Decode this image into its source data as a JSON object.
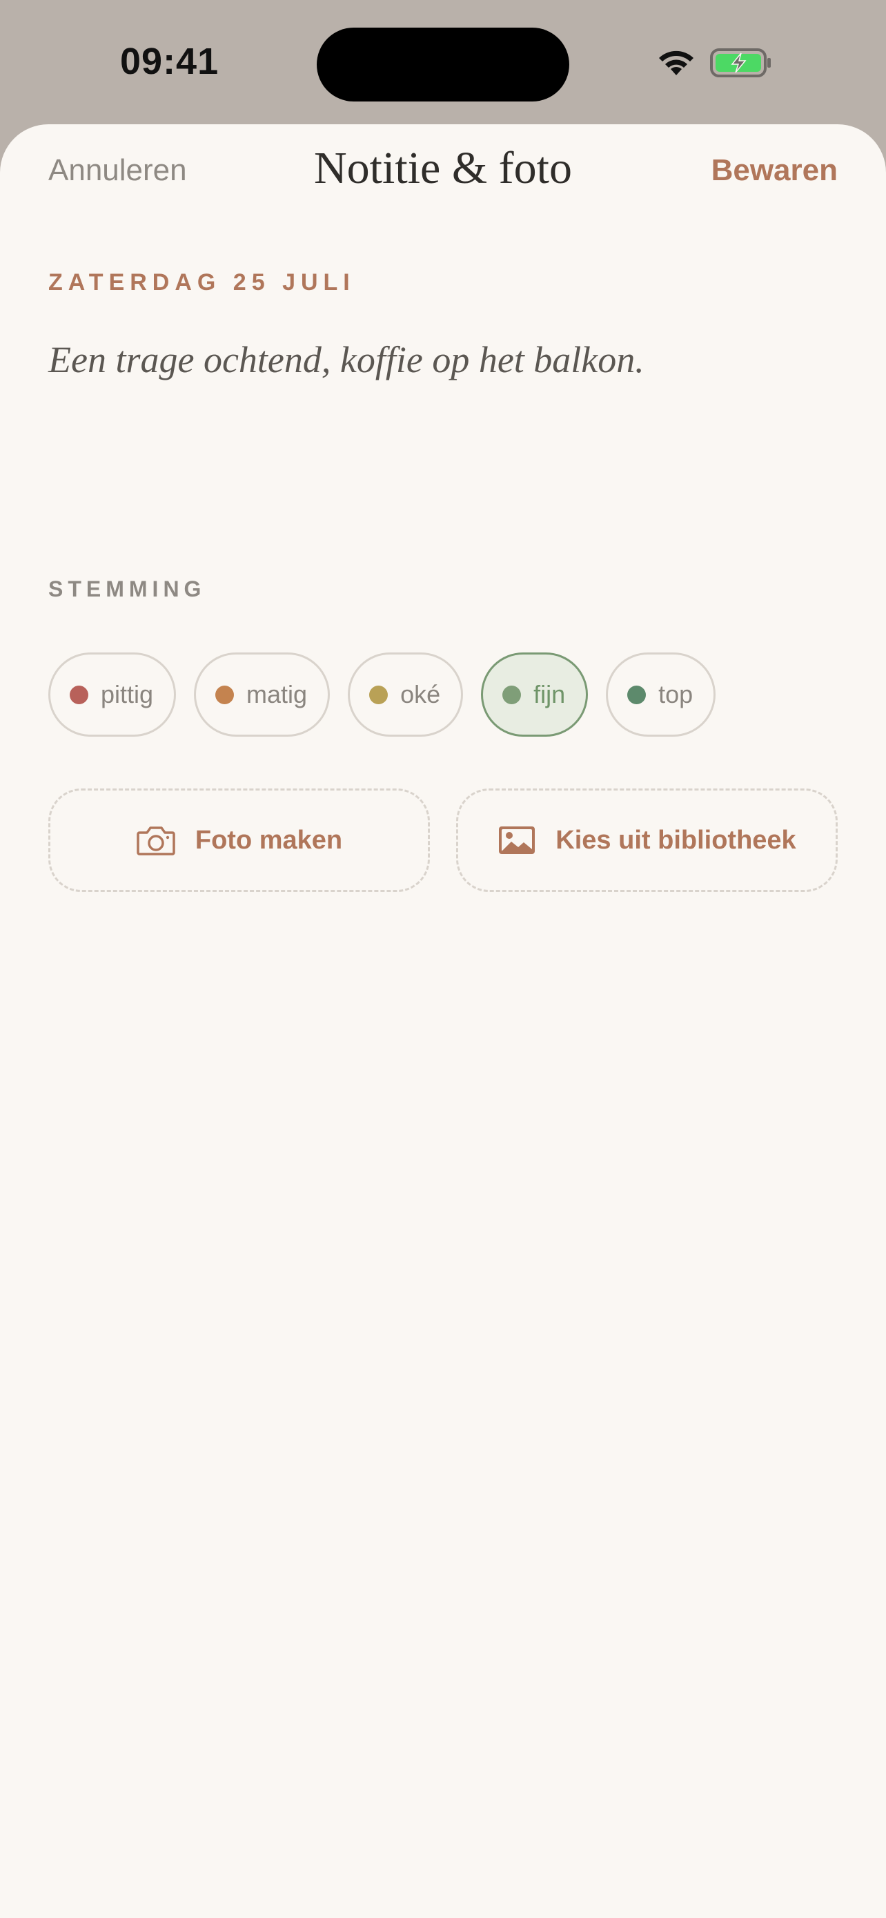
{
  "status_bar": {
    "time": "09:41",
    "icons": [
      "wifi-icon",
      "battery-charging-icon"
    ],
    "battery_color": "#4cd964"
  },
  "nav": {
    "cancel_label": "Annuleren",
    "title": "Notitie & foto",
    "save_label": "Bewaren"
  },
  "entry": {
    "date": "ZATERDAG 25 JULI",
    "note": "Een trage ochtend, koffie op het balkon."
  },
  "mood": {
    "heading": "STEMMING",
    "selected": "fijn",
    "options": [
      {
        "label": "pittig",
        "color": "#b8615a"
      },
      {
        "label": "matig",
        "color": "#c4834f"
      },
      {
        "label": "oké",
        "color": "#b9a156"
      },
      {
        "label": "fijn",
        "color": "#7f9e78"
      },
      {
        "label": "top",
        "color": "#5d8a6c"
      }
    ]
  },
  "photo_actions": {
    "take_photo_label": "Foto maken",
    "take_photo_icon": "camera-icon",
    "library_label": "Kies uit bibliotheek",
    "library_icon": "image-icon"
  },
  "colors": {
    "accent": "#b0765a",
    "sheet_background": "#faf7f3",
    "backdrop": "#b9b1aa"
  }
}
